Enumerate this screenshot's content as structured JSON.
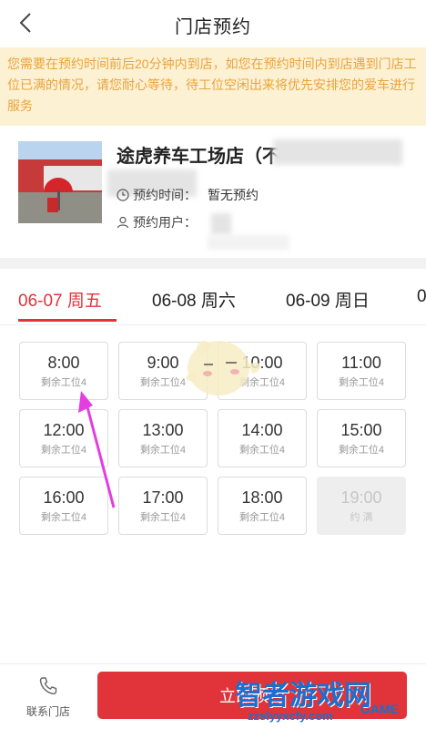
{
  "header": {
    "title": "门店预约",
    "back_icon": "chevron-left-icon"
  },
  "notice": {
    "text": "您需要在预约时间前后20分钟内到店，如您在预约时间内到店遇到门店工位已满的情况，请您耐心等待，待工位空闲出来将优先安排您的爱车进行服务"
  },
  "store": {
    "name": "途虎养车工场店（不",
    "time_label": "预约时间：",
    "time_value": "暂无预约",
    "user_label": "预约用户："
  },
  "tabs": [
    {
      "label": "06-07 周五",
      "active": true
    },
    {
      "label": "06-08 周六",
      "active": false
    },
    {
      "label": "06-09 周日",
      "active": false
    },
    {
      "label": "0",
      "active": false
    }
  ],
  "slots": [
    {
      "time": "8:00",
      "remain": "剩余工位4",
      "full": false
    },
    {
      "time": "9:00",
      "remain": "剩余工位4",
      "full": false
    },
    {
      "time": "10:00",
      "remain": "剩余工位4",
      "full": false
    },
    {
      "time": "11:00",
      "remain": "剩余工位4",
      "full": false
    },
    {
      "time": "12:00",
      "remain": "剩余工位4",
      "full": false
    },
    {
      "time": "13:00",
      "remain": "剩余工位4",
      "full": false
    },
    {
      "time": "14:00",
      "remain": "剩余工位4",
      "full": false
    },
    {
      "time": "15:00",
      "remain": "剩余工位4",
      "full": false
    },
    {
      "time": "16:00",
      "remain": "剩余工位4",
      "full": false
    },
    {
      "time": "17:00",
      "remain": "剩余工位4",
      "full": false
    },
    {
      "time": "18:00",
      "remain": "剩余工位4",
      "full": false
    },
    {
      "time": "19:00",
      "remain": "约 满",
      "full": true
    }
  ],
  "bottom": {
    "contact_label": "联系门店",
    "book_label": "立即预约"
  },
  "watermark": {
    "title": "智者游戏网",
    "url": "zzslyyxcfy.com",
    "game": "GAME"
  },
  "colors": {
    "accent": "#e0343a",
    "notice_bg": "#fdf1d4",
    "notice_text": "#e9a33b"
  }
}
